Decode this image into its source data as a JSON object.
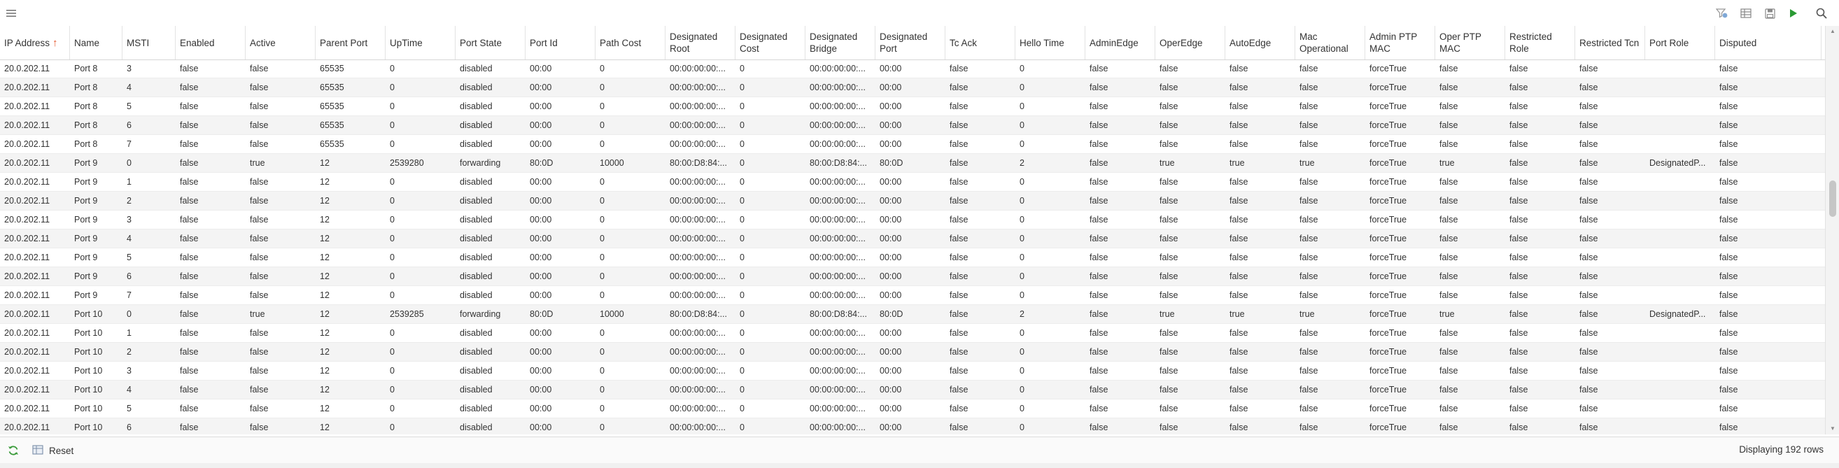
{
  "toolbar": {
    "menu_icon": "hamburger-menu-icon",
    "right_icons": [
      "filter-view-icon",
      "columns-icon",
      "save-icon",
      "play-icon",
      "search-icon"
    ]
  },
  "table": {
    "columns": [
      {
        "label": "IP Address",
        "sorted": "asc"
      },
      {
        "label": "Name"
      },
      {
        "label": "MSTI"
      },
      {
        "label": "Enabled"
      },
      {
        "label": "Active"
      },
      {
        "label": "Parent Port"
      },
      {
        "label": "UpTime"
      },
      {
        "label": "Port State"
      },
      {
        "label": "Port Id"
      },
      {
        "label": "Path Cost"
      },
      {
        "label": "Designated Root"
      },
      {
        "label": "Designated Cost"
      },
      {
        "label": "Designated Bridge"
      },
      {
        "label": "Designated Port"
      },
      {
        "label": "Tc Ack"
      },
      {
        "label": "Hello Time"
      },
      {
        "label": "AdminEdge"
      },
      {
        "label": "OperEdge"
      },
      {
        "label": "AutoEdge"
      },
      {
        "label": "Mac Operational"
      },
      {
        "label": "Admin PTP MAC"
      },
      {
        "label": "Oper PTP MAC"
      },
      {
        "label": "Restricted Role"
      },
      {
        "label": "Restricted Tcn"
      },
      {
        "label": "Port Role"
      },
      {
        "label": "Disputed"
      }
    ],
    "rows": [
      [
        "20.0.202.11",
        "Port 8",
        "3",
        "false",
        "false",
        "65535",
        "0",
        "disabled",
        "00:00",
        "0",
        "00:00:00:00:...",
        "0",
        "00:00:00:00:...",
        "00:00",
        "false",
        "0",
        "false",
        "false",
        "false",
        "false",
        "forceTrue",
        "false",
        "false",
        "false",
        "",
        "false"
      ],
      [
        "20.0.202.11",
        "Port 8",
        "4",
        "false",
        "false",
        "65535",
        "0",
        "disabled",
        "00:00",
        "0",
        "00:00:00:00:...",
        "0",
        "00:00:00:00:...",
        "00:00",
        "false",
        "0",
        "false",
        "false",
        "false",
        "false",
        "forceTrue",
        "false",
        "false",
        "false",
        "",
        "false"
      ],
      [
        "20.0.202.11",
        "Port 8",
        "5",
        "false",
        "false",
        "65535",
        "0",
        "disabled",
        "00:00",
        "0",
        "00:00:00:00:...",
        "0",
        "00:00:00:00:...",
        "00:00",
        "false",
        "0",
        "false",
        "false",
        "false",
        "false",
        "forceTrue",
        "false",
        "false",
        "false",
        "",
        "false"
      ],
      [
        "20.0.202.11",
        "Port 8",
        "6",
        "false",
        "false",
        "65535",
        "0",
        "disabled",
        "00:00",
        "0",
        "00:00:00:00:...",
        "0",
        "00:00:00:00:...",
        "00:00",
        "false",
        "0",
        "false",
        "false",
        "false",
        "false",
        "forceTrue",
        "false",
        "false",
        "false",
        "",
        "false"
      ],
      [
        "20.0.202.11",
        "Port 8",
        "7",
        "false",
        "false",
        "65535",
        "0",
        "disabled",
        "00:00",
        "0",
        "00:00:00:00:...",
        "0",
        "00:00:00:00:...",
        "00:00",
        "false",
        "0",
        "false",
        "false",
        "false",
        "false",
        "forceTrue",
        "false",
        "false",
        "false",
        "",
        "false"
      ],
      [
        "20.0.202.11",
        "Port 9",
        "0",
        "false",
        "true",
        "12",
        "2539280",
        "forwarding",
        "80:0D",
        "10000",
        "80:00:D8:84:...",
        "0",
        "80:00:D8:84:...",
        "80:0D",
        "false",
        "2",
        "false",
        "true",
        "true",
        "true",
        "forceTrue",
        "true",
        "false",
        "false",
        "DesignatedP...",
        "false"
      ],
      [
        "20.0.202.11",
        "Port 9",
        "1",
        "false",
        "false",
        "12",
        "0",
        "disabled",
        "00:00",
        "0",
        "00:00:00:00:...",
        "0",
        "00:00:00:00:...",
        "00:00",
        "false",
        "0",
        "false",
        "false",
        "false",
        "false",
        "forceTrue",
        "false",
        "false",
        "false",
        "",
        "false"
      ],
      [
        "20.0.202.11",
        "Port 9",
        "2",
        "false",
        "false",
        "12",
        "0",
        "disabled",
        "00:00",
        "0",
        "00:00:00:00:...",
        "0",
        "00:00:00:00:...",
        "00:00",
        "false",
        "0",
        "false",
        "false",
        "false",
        "false",
        "forceTrue",
        "false",
        "false",
        "false",
        "",
        "false"
      ],
      [
        "20.0.202.11",
        "Port 9",
        "3",
        "false",
        "false",
        "12",
        "0",
        "disabled",
        "00:00",
        "0",
        "00:00:00:00:...",
        "0",
        "00:00:00:00:...",
        "00:00",
        "false",
        "0",
        "false",
        "false",
        "false",
        "false",
        "forceTrue",
        "false",
        "false",
        "false",
        "",
        "false"
      ],
      [
        "20.0.202.11",
        "Port 9",
        "4",
        "false",
        "false",
        "12",
        "0",
        "disabled",
        "00:00",
        "0",
        "00:00:00:00:...",
        "0",
        "00:00:00:00:...",
        "00:00",
        "false",
        "0",
        "false",
        "false",
        "false",
        "false",
        "forceTrue",
        "false",
        "false",
        "false",
        "",
        "false"
      ],
      [
        "20.0.202.11",
        "Port 9",
        "5",
        "false",
        "false",
        "12",
        "0",
        "disabled",
        "00:00",
        "0",
        "00:00:00:00:...",
        "0",
        "00:00:00:00:...",
        "00:00",
        "false",
        "0",
        "false",
        "false",
        "false",
        "false",
        "forceTrue",
        "false",
        "false",
        "false",
        "",
        "false"
      ],
      [
        "20.0.202.11",
        "Port 9",
        "6",
        "false",
        "false",
        "12",
        "0",
        "disabled",
        "00:00",
        "0",
        "00:00:00:00:...",
        "0",
        "00:00:00:00:...",
        "00:00",
        "false",
        "0",
        "false",
        "false",
        "false",
        "false",
        "forceTrue",
        "false",
        "false",
        "false",
        "",
        "false"
      ],
      [
        "20.0.202.11",
        "Port 9",
        "7",
        "false",
        "false",
        "12",
        "0",
        "disabled",
        "00:00",
        "0",
        "00:00:00:00:...",
        "0",
        "00:00:00:00:...",
        "00:00",
        "false",
        "0",
        "false",
        "false",
        "false",
        "false",
        "forceTrue",
        "false",
        "false",
        "false",
        "",
        "false"
      ],
      [
        "20.0.202.11",
        "Port 10",
        "0",
        "false",
        "true",
        "12",
        "2539285",
        "forwarding",
        "80:0D",
        "10000",
        "80:00:D8:84:...",
        "0",
        "80:00:D8:84:...",
        "80:0D",
        "false",
        "2",
        "false",
        "true",
        "true",
        "true",
        "forceTrue",
        "true",
        "false",
        "false",
        "DesignatedP...",
        "false"
      ],
      [
        "20.0.202.11",
        "Port 10",
        "1",
        "false",
        "false",
        "12",
        "0",
        "disabled",
        "00:00",
        "0",
        "00:00:00:00:...",
        "0",
        "00:00:00:00:...",
        "00:00",
        "false",
        "0",
        "false",
        "false",
        "false",
        "false",
        "forceTrue",
        "false",
        "false",
        "false",
        "",
        "false"
      ],
      [
        "20.0.202.11",
        "Port 10",
        "2",
        "false",
        "false",
        "12",
        "0",
        "disabled",
        "00:00",
        "0",
        "00:00:00:00:...",
        "0",
        "00:00:00:00:...",
        "00:00",
        "false",
        "0",
        "false",
        "false",
        "false",
        "false",
        "forceTrue",
        "false",
        "false",
        "false",
        "",
        "false"
      ],
      [
        "20.0.202.11",
        "Port 10",
        "3",
        "false",
        "false",
        "12",
        "0",
        "disabled",
        "00:00",
        "0",
        "00:00:00:00:...",
        "0",
        "00:00:00:00:...",
        "00:00",
        "false",
        "0",
        "false",
        "false",
        "false",
        "false",
        "forceTrue",
        "false",
        "false",
        "false",
        "",
        "false"
      ],
      [
        "20.0.202.11",
        "Port 10",
        "4",
        "false",
        "false",
        "12",
        "0",
        "disabled",
        "00:00",
        "0",
        "00:00:00:00:...",
        "0",
        "00:00:00:00:...",
        "00:00",
        "false",
        "0",
        "false",
        "false",
        "false",
        "false",
        "forceTrue",
        "false",
        "false",
        "false",
        "",
        "false"
      ],
      [
        "20.0.202.11",
        "Port 10",
        "5",
        "false",
        "false",
        "12",
        "0",
        "disabled",
        "00:00",
        "0",
        "00:00:00:00:...",
        "0",
        "00:00:00:00:...",
        "00:00",
        "false",
        "0",
        "false",
        "false",
        "false",
        "false",
        "forceTrue",
        "false",
        "false",
        "false",
        "",
        "false"
      ],
      [
        "20.0.202.11",
        "Port 10",
        "6",
        "false",
        "false",
        "12",
        "0",
        "disabled",
        "00:00",
        "0",
        "00:00:00:00:...",
        "0",
        "00:00:00:00:...",
        "00:00",
        "false",
        "0",
        "false",
        "false",
        "false",
        "false",
        "forceTrue",
        "false",
        "false",
        "false",
        "",
        "false"
      ]
    ]
  },
  "footer": {
    "reset_label": "Reset",
    "status_text": "Displaying 192 rows"
  },
  "colors": {
    "sort_arrow": "#e3542b",
    "play_icon": "#2a9a34",
    "refresh_icon": "#3a9b3a"
  }
}
